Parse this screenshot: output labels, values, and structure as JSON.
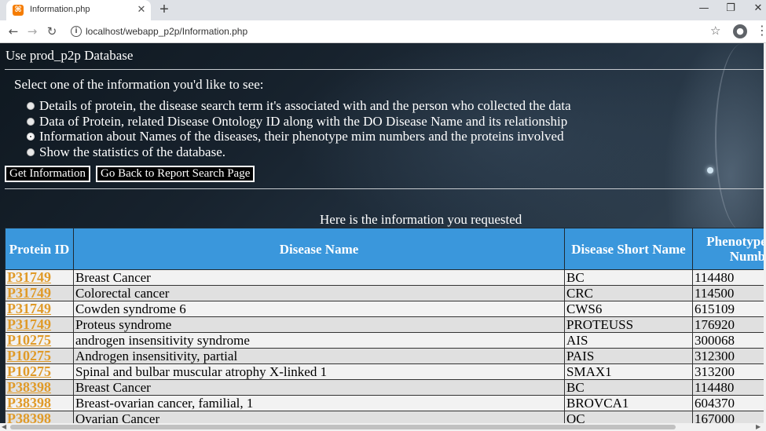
{
  "browser": {
    "tab_title": "Information.php",
    "tab_favicon": "⌘",
    "close_glyph": "✕",
    "newtab_glyph": "+",
    "url": "localhost/webapp_p2p/Information.php",
    "window_controls": {
      "minimize": "—",
      "maximize": "❐",
      "close": "✕"
    },
    "nav": {
      "back": "←",
      "forward": "→",
      "reload": "↻"
    },
    "icons": {
      "info": "i",
      "star": "☆",
      "account": "●",
      "menu": "⋮"
    }
  },
  "page": {
    "db_title": "Use prod_p2p Database",
    "prompt": "Select one of the information you'd like to see:",
    "options": [
      {
        "label": "Details of protein, the disease search term it's associated with and the person who collected the data",
        "selected": false
      },
      {
        "label": "Data of Protein, related Disease Ontology ID along with the DO Disease Name and its relationship",
        "selected": false
      },
      {
        "label": "Information about Names of the diseases, their phenotype mim numbers and the proteins involved",
        "selected": true
      },
      {
        "label": "Show the statistics of the database.",
        "selected": false
      }
    ],
    "buttons": {
      "get_info": "Get Information",
      "back": "Go Back to Report Search Page"
    },
    "result_caption": "Here is the information you requested"
  },
  "table": {
    "headers": [
      "Protein ID",
      "Disease Name",
      "Disease Short Name",
      "Phenotype MIM Number"
    ],
    "rows": [
      [
        "P31749",
        "Breast Cancer",
        "BC",
        "114480"
      ],
      [
        "P31749",
        "Colorectal cancer",
        "CRC",
        "114500"
      ],
      [
        "P31749",
        "Cowden syndrome 6",
        "CWS6",
        "615109"
      ],
      [
        "P31749",
        "Proteus syndrome",
        "PROTEUSS",
        "176920"
      ],
      [
        "P10275",
        "androgen insensitivity syndrome",
        "AIS",
        "300068"
      ],
      [
        "P10275",
        "Androgen insensitivity, partial",
        "PAIS",
        "312300"
      ],
      [
        "P10275",
        "Spinal and bulbar muscular atrophy X-linked 1",
        "SMAX1",
        "313200"
      ],
      [
        "P38398",
        "Breast Cancer",
        "BC",
        "114480"
      ],
      [
        "P38398",
        "Breast-ovarian cancer, familial, 1",
        "BROVCA1",
        "604370"
      ],
      [
        "P38398",
        "Ovarian Cancer",
        "OC",
        "167000"
      ]
    ]
  },
  "scroll": {
    "left_arrow": "◀",
    "right_arrow": "▶"
  }
}
